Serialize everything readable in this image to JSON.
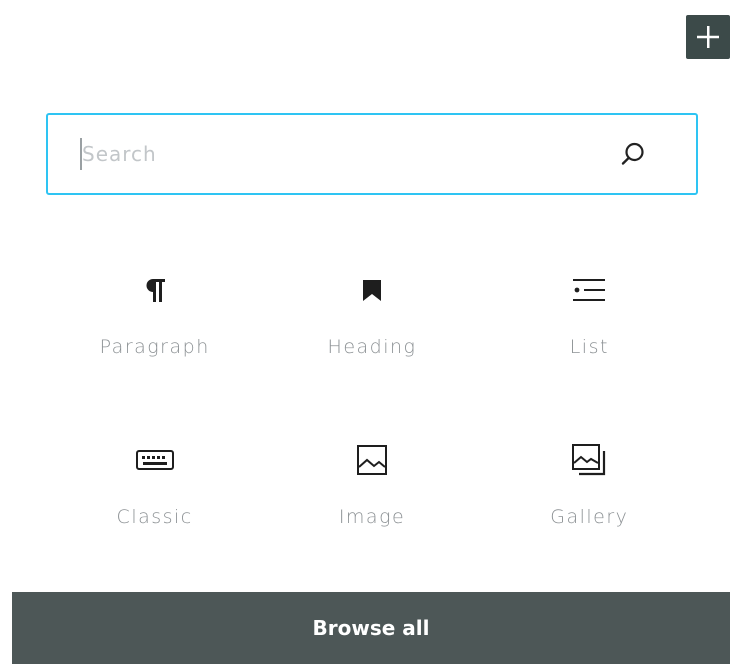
{
  "toolbar": {
    "add_button_icon": "plus-icon"
  },
  "search": {
    "placeholder": "Search",
    "value": "",
    "icon": "search-icon"
  },
  "blocks": [
    {
      "label": "Paragraph",
      "icon": "paragraph-icon"
    },
    {
      "label": "Heading",
      "icon": "bookmark-icon"
    },
    {
      "label": "List",
      "icon": "list-icon"
    },
    {
      "label": "Classic",
      "icon": "keyboard-icon"
    },
    {
      "label": "Image",
      "icon": "image-icon"
    },
    {
      "label": "Gallery",
      "icon": "gallery-icon"
    }
  ],
  "footer": {
    "browse_all_label": "Browse all"
  },
  "colors": {
    "accent": "#2ec4f3",
    "dark": "#3c4a49",
    "footer_bg": "#4d5757",
    "label_gray": "#8c9194"
  }
}
